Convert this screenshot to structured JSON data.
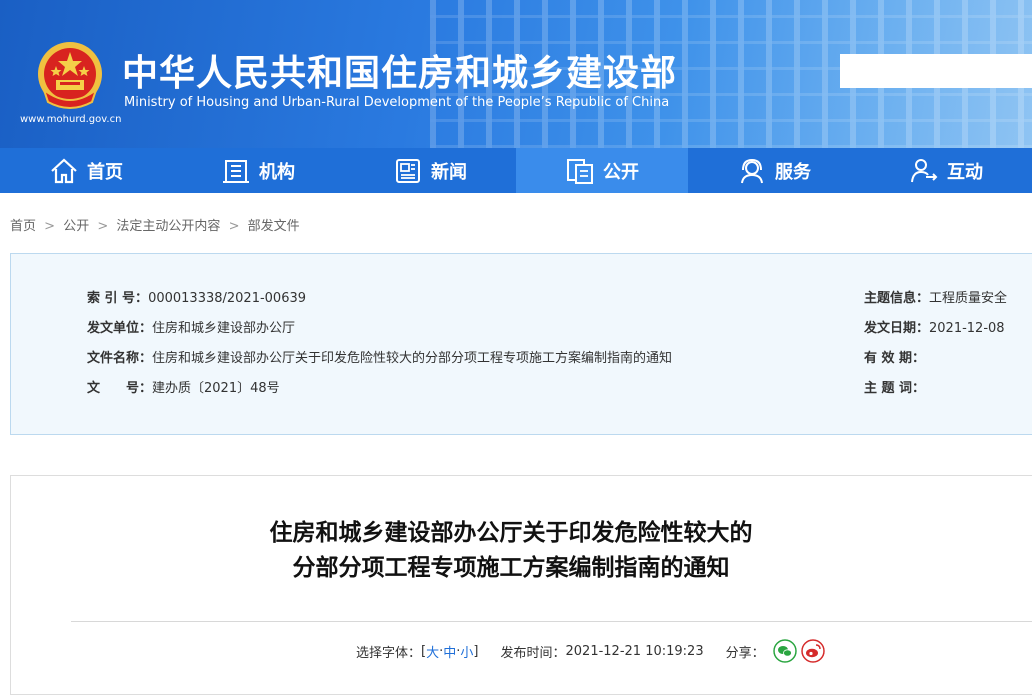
{
  "header": {
    "title": "中华人民共和国住房和城乡建设部",
    "title_en": "Ministry of Housing and Urban-Rural Development of the People’s Republic of China",
    "url": "www.mohurd.gov.cn"
  },
  "search": {
    "placeholder": ""
  },
  "nav": {
    "items": [
      {
        "label": "首页",
        "icon": "home-icon"
      },
      {
        "label": "机构",
        "icon": "building-icon"
      },
      {
        "label": "新闻",
        "icon": "news-icon"
      },
      {
        "label": "公开",
        "icon": "documents-icon",
        "active": true
      },
      {
        "label": "服务",
        "icon": "service-icon"
      },
      {
        "label": "互动",
        "icon": "interaction-icon"
      }
    ]
  },
  "breadcrumb": {
    "items": [
      "首页",
      "公开",
      "法定主动公开内容",
      "部发文件"
    ],
    "separator": ">"
  },
  "meta": {
    "index_label": "索 引 号：",
    "index_value": "000013338/2021-00639",
    "issuer_label": "发文单位：",
    "issuer_value": "住房和城乡建设部办公厅",
    "filename_label": "文件名称：",
    "filename_value": "住房和城乡建设部办公厅关于印发危险性较大的分部分项工程专项施工方案编制指南的通知",
    "docno_label": "文　　号：",
    "docno_value": "建办质〔2021〕48号",
    "topic_label": "主题信息：",
    "topic_value": "工程质量安全",
    "date_label": "发文日期：",
    "date_value": "2021-12-08",
    "validity_label": "有 效 期：",
    "validity_value": "",
    "keywords_label": "主 题 词：",
    "keywords_value": ""
  },
  "article": {
    "title_line1": "住房和城乡建设部办公厅关于印发危险性较大的",
    "title_line2": "分部分项工程专项施工方案编制指南的通知",
    "font_label": "选择字体：",
    "bracket_open": "[",
    "font_large": "大",
    "font_medium": "中",
    "font_small": "小",
    "bracket_close": "]",
    "dash": "·",
    "publish_label": "发布时间：",
    "publish_value": "2021-12-21 10:19:23",
    "share_label": "分享："
  },
  "colors": {
    "nav_bg": "#1f6fd8",
    "nav_active": "#3a8ceb",
    "meta_bg": "#f1f8fd",
    "wechat": "#2aa540",
    "weibo": "#d52b2b"
  }
}
